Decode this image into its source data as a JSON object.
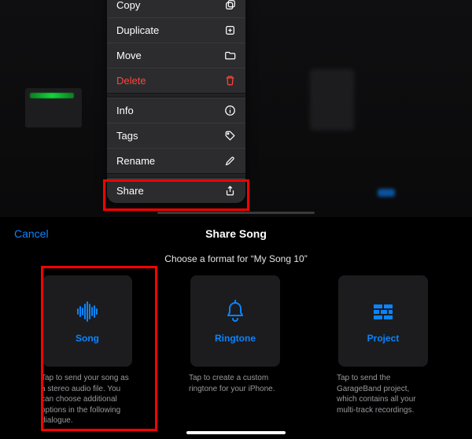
{
  "menu": {
    "items": [
      {
        "label": "Copy",
        "icon": "copy-icon",
        "danger": false,
        "sep_after": false
      },
      {
        "label": "Duplicate",
        "icon": "duplicate-icon",
        "danger": false,
        "sep_after": false
      },
      {
        "label": "Move",
        "icon": "folder-icon",
        "danger": false,
        "sep_after": false
      },
      {
        "label": "Delete",
        "icon": "trash-icon",
        "danger": true,
        "sep_after": true
      },
      {
        "label": "Info",
        "icon": "info-icon",
        "danger": false,
        "sep_after": false
      },
      {
        "label": "Tags",
        "icon": "tag-icon",
        "danger": false,
        "sep_after": false
      },
      {
        "label": "Rename",
        "icon": "pencil-icon",
        "danger": false,
        "sep_after": true
      },
      {
        "label": "Share",
        "icon": "share-icon",
        "danger": false,
        "sep_after": false
      }
    ]
  },
  "sheet": {
    "cancel": "Cancel",
    "title": "Share Song",
    "prompt": "Choose a format for “My Song 10”",
    "options": [
      {
        "name": "Song",
        "icon": "waveform-icon",
        "desc": "Tap to send your song as a stereo audio file. You can choose additional options in the following dialogue."
      },
      {
        "name": "Ringtone",
        "icon": "bell-icon",
        "desc": "Tap to create a custom ringtone for your iPhone."
      },
      {
        "name": "Project",
        "icon": "bricks-icon",
        "desc": "Tap to send the GarageBand project, which contains all your multi-track recordings."
      }
    ]
  },
  "accent": "#0a84ff",
  "highlight": "#ff0000"
}
